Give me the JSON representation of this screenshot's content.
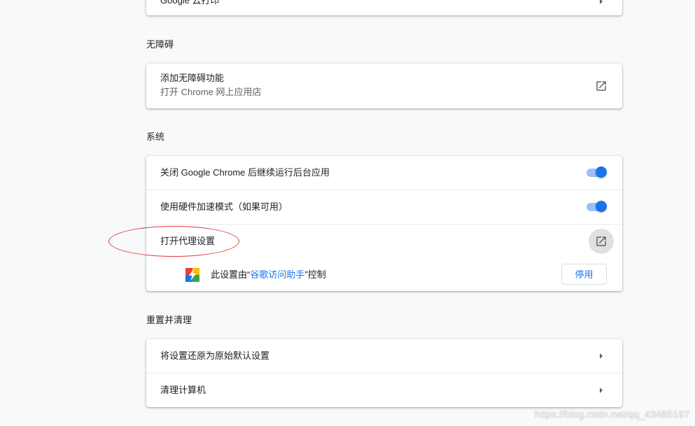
{
  "colors": {
    "background": "#f8f9fa",
    "card": "#ffffff",
    "accent": "#1a73e8",
    "toggle_track": "#8ab4f8",
    "annotation": "#e23b3b"
  },
  "partial_card": {
    "label": "Google 云打印",
    "icon": "arrow-right-icon"
  },
  "accessibility": {
    "section_title": "无障碍",
    "item": {
      "title": "添加无障碍功能",
      "subtitle": "打开 Chrome 网上应用店",
      "icon": "open-in-new-icon"
    }
  },
  "system": {
    "section_title": "系统",
    "items": [
      {
        "label": "关闭 Google Chrome 后继续运行后台应用",
        "control": "toggle",
        "checked": true
      },
      {
        "label": "使用硬件加速模式（如果可用）",
        "control": "toggle",
        "checked": true
      },
      {
        "label": "打开代理设置",
        "control": "open-in-new-icon"
      }
    ],
    "extension_notice": {
      "prefix": "此设置由“",
      "extension_name": "谷歌访问助手",
      "suffix": "”控制",
      "icon": "extension-lightning-icon",
      "button_label": "停用"
    }
  },
  "reset": {
    "section_title": "重置并清理",
    "items": [
      {
        "label": "将设置还原为原始默认设置",
        "icon": "arrow-right-icon"
      },
      {
        "label": "清理计算机",
        "icon": "arrow-right-icon"
      }
    ]
  },
  "watermark": "https://blog.csdn.net/qq_43485197"
}
